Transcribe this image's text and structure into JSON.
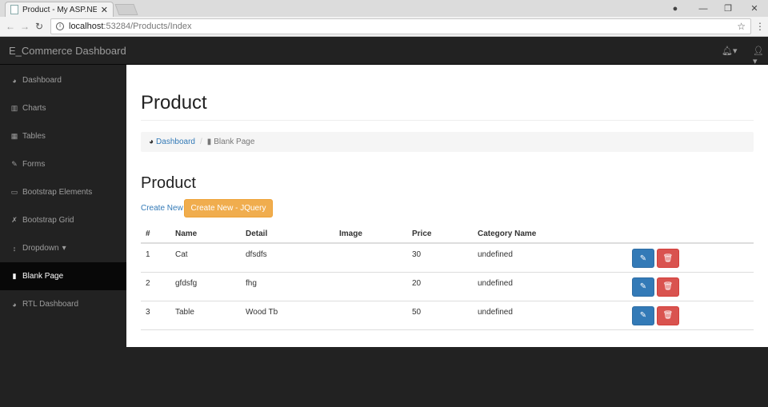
{
  "browser": {
    "tab_title": "Product - My ASP.NET A",
    "url_host": "localhost",
    "url_path": ":53284/Products/Index"
  },
  "navbar": {
    "brand": "E_Commerce Dashboard",
    "bell_caret": "▾",
    "user_caret": "▾"
  },
  "sidebar": {
    "items": [
      {
        "label": "Dashboard",
        "icon": "dashboard-icon"
      },
      {
        "label": "Charts",
        "icon": "bar-chart-icon"
      },
      {
        "label": "Tables",
        "icon": "table-icon"
      },
      {
        "label": "Forms",
        "icon": "edit-icon"
      },
      {
        "label": "Bootstrap Elements",
        "icon": "desktop-icon"
      },
      {
        "label": "Bootstrap Grid",
        "icon": "wrench-icon"
      },
      {
        "label": "Dropdown",
        "icon": "arrows-v-icon"
      },
      {
        "label": "Blank Page",
        "icon": "file-icon"
      },
      {
        "label": "RTL Dashboard",
        "icon": "dashboard-icon"
      }
    ],
    "active": "Blank Page"
  },
  "main": {
    "page_title": "Product",
    "breadcrumb": {
      "link": "Dashboard",
      "current": "Blank Page"
    },
    "section_title": "Product",
    "create_new": "Create New",
    "create_new_jquery": "Create New - JQuery",
    "table": {
      "headers": [
        "#",
        "Name",
        "Detail",
        "Image",
        "Price",
        "Category Name"
      ],
      "rows": [
        [
          "1",
          "Cat",
          "dfsdfs",
          "",
          "30",
          "undefined"
        ],
        [
          "2",
          "gfdsfg",
          "fhg",
          "",
          "20",
          "undefined"
        ],
        [
          "3",
          "Table",
          "Wood Tb",
          "",
          "50",
          "undefined"
        ]
      ]
    }
  },
  "colors": {
    "primary": "#337ab7",
    "warning": "#f0ad4e",
    "danger": "#d9534f",
    "navbar": "#222222"
  }
}
